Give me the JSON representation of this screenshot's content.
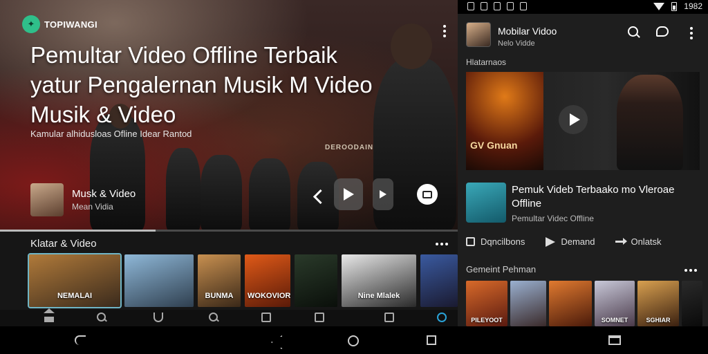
{
  "status_bar": {
    "time": "1982"
  },
  "hero": {
    "brand": "TOPIWANGI",
    "title_lines": [
      "Pemultar Video Offline Terbaik",
      "yatur Pengalernan Musik  M Video",
      "Musik  & Video"
    ],
    "subtitle": "Kamular alhidusloas Ofline Idear Rantod",
    "poster_text": "DEROODAIN",
    "artist_name": "Musk & Video",
    "artist_sub": "Mean Vidia",
    "progress": 0.34
  },
  "left_section": {
    "title": "Klatar & Video",
    "thumbs": [
      {
        "caption": "NEMALAI",
        "colors": [
          "#b07a3a",
          "#3a2a1c"
        ]
      },
      {
        "caption": "",
        "colors": [
          "#8fb8d8",
          "#2f3f4f"
        ]
      },
      {
        "caption": "BUNMA",
        "colors": [
          "#c89050",
          "#3a2818"
        ]
      },
      {
        "caption": "WOKOVIOR",
        "colors": [
          "#e05a18",
          "#5a1a08"
        ]
      },
      {
        "caption": "",
        "colors": [
          "#2a3a2a",
          "#0a0f0a"
        ]
      },
      {
        "caption": "Nine Mlalek",
        "colors": [
          "#e8e8e8",
          "#2a2a2a"
        ]
      },
      {
        "caption": "",
        "colors": [
          "#3a5aa0",
          "#1a1a30"
        ]
      }
    ]
  },
  "right_pane": {
    "header_title": "Mobilar Vidoo",
    "header_subtitle": "Nelo Vidde",
    "section1": "Hlatarnaos",
    "featured_caption": "GV Gnuan",
    "item_title": "Pemuk Videb Terbaako mo Vleroae Offline",
    "item_sub": "Pemultar Videc Offline",
    "actions": [
      "Dqncilbons",
      "Demand",
      "Onlatsk"
    ],
    "section2": "Gemeint Pehman",
    "thumbs": [
      {
        "caption": "PILEYOOT",
        "colors": [
          "#d86a2a",
          "#5a1a10"
        ]
      },
      {
        "caption": "",
        "colors": [
          "#9ab0d0",
          "#3a2a2a"
        ]
      },
      {
        "caption": "",
        "colors": [
          "#e07a30",
          "#4a1a0a"
        ]
      },
      {
        "caption": "SOMNET",
        "colors": [
          "#c8c8d8",
          "#4a3a4a"
        ]
      },
      {
        "caption": "SGHIAR",
        "colors": [
          "#d8a050",
          "#3a2010"
        ]
      },
      {
        "caption": "",
        "colors": [
          "#2a2a2a",
          "#0a0a0a"
        ]
      }
    ]
  }
}
